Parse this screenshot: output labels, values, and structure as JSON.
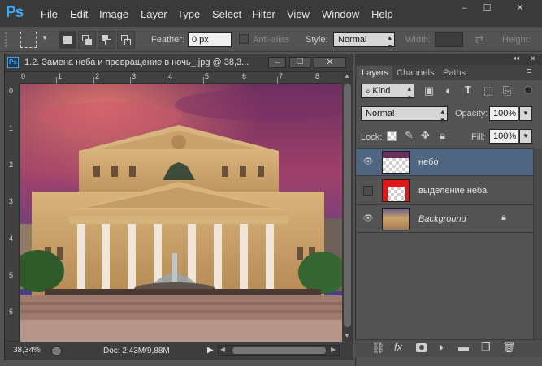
{
  "app": {
    "logo": "Ps"
  },
  "menu": [
    "File",
    "Edit",
    "Image",
    "Layer",
    "Type",
    "Select",
    "Filter",
    "View",
    "Window",
    "Help"
  ],
  "window_controls": [
    "–",
    "☐",
    "✕"
  ],
  "options": {
    "feather_label": "Feather:",
    "feather_value": "0 px",
    "antialias_label": "Anti-alias",
    "style_label": "Style:",
    "style_value": "Normal",
    "width_label": "Width:",
    "height_label": "Height:"
  },
  "document": {
    "ps_badge": "Ps",
    "title": "1.2. Замена неба и превращение в ночь_.jpg @ 38,3...",
    "ruler_h": [
      "0",
      "1",
      "2",
      "3",
      "4",
      "5",
      "6",
      "7",
      "8"
    ],
    "ruler_v": [
      "0",
      "1",
      "2",
      "3",
      "4",
      "5",
      "6"
    ],
    "zoom": "38,34%",
    "doc_info": "Doc: 2,43M/9,88M"
  },
  "panel": {
    "tabs": [
      "Layers",
      "Channels",
      "Paths"
    ],
    "kind_label": "Kind",
    "blend_mode": "Normal",
    "opacity_label": "Opacity:",
    "opacity_value": "100%",
    "lock_label": "Lock:",
    "fill_label": "Fill:",
    "fill_value": "100%",
    "layers": [
      {
        "name": "небо",
        "visible": true,
        "selected": true
      },
      {
        "name": "выделение неба",
        "visible": false,
        "selected": false
      },
      {
        "name": "Background",
        "visible": true,
        "selected": false,
        "locked": true
      }
    ]
  },
  "colors": {
    "accent": "#3da7f2",
    "selected_layer": "#4f6580",
    "chrome": "#535353",
    "dark": "#3a3a3a"
  }
}
